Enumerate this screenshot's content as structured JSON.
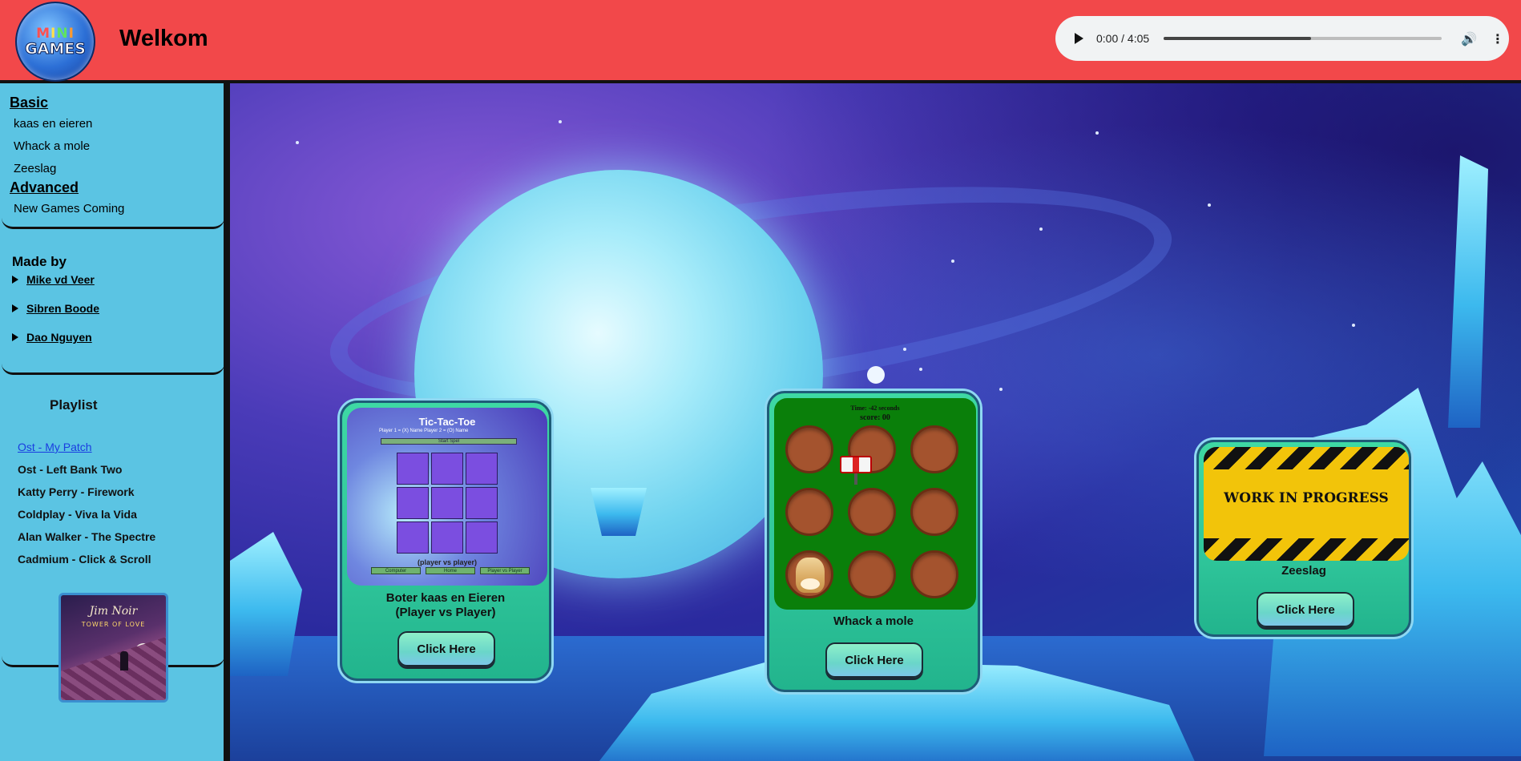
{
  "header": {
    "logo_line1": "MINI",
    "logo_line2": "GAMES",
    "title": "Welkom",
    "audio": {
      "time": "0:00 / 4:05",
      "progress": 0.53
    }
  },
  "sidebar": {
    "basic_heading": "Basic",
    "basic_items": [
      "kaas en eieren",
      "Whack a mole",
      "Zeeslag"
    ],
    "advanced_heading": "Advanced",
    "advanced_items": [
      "New Games Coming"
    ],
    "made_by": "Made by",
    "authors": [
      "Mike vd Veer",
      "Sibren Boode",
      "Dao Nguyen"
    ],
    "playlist_title": "Playlist",
    "songs": [
      "Ost - My Patch",
      "Ost - Left Bank Two",
      "Katty Perry - Firework",
      "Coldplay - Viva la Vida",
      "Alan Walker - The Spectre",
      "Cadmium - Click & Scroll"
    ],
    "album": {
      "artist": "Jim Noir",
      "title": "TOWER OF LOVE"
    }
  },
  "cards": {
    "ttt": {
      "preview_title": "Tic-Tac-Toe",
      "preview_players": "Player 1 = (X)  Name   Player 2 = (O)  Name",
      "preview_start": "Start Spel",
      "preview_mode": "(player vs player)",
      "preview_buttons": [
        "Computer",
        "Home",
        "Player vs Player"
      ],
      "name": "Boter kaas en Eieren (Player vs Player)",
      "button": "Click Here"
    },
    "mole": {
      "preview_time": "Time: -42 seconds",
      "preview_score": "score: 00",
      "name": "Whack a mole",
      "button": "Click Here"
    },
    "zeeslag": {
      "preview_text": "WORK IN PROGRESS",
      "name": "Zeeslag",
      "button": "Click Here"
    }
  }
}
